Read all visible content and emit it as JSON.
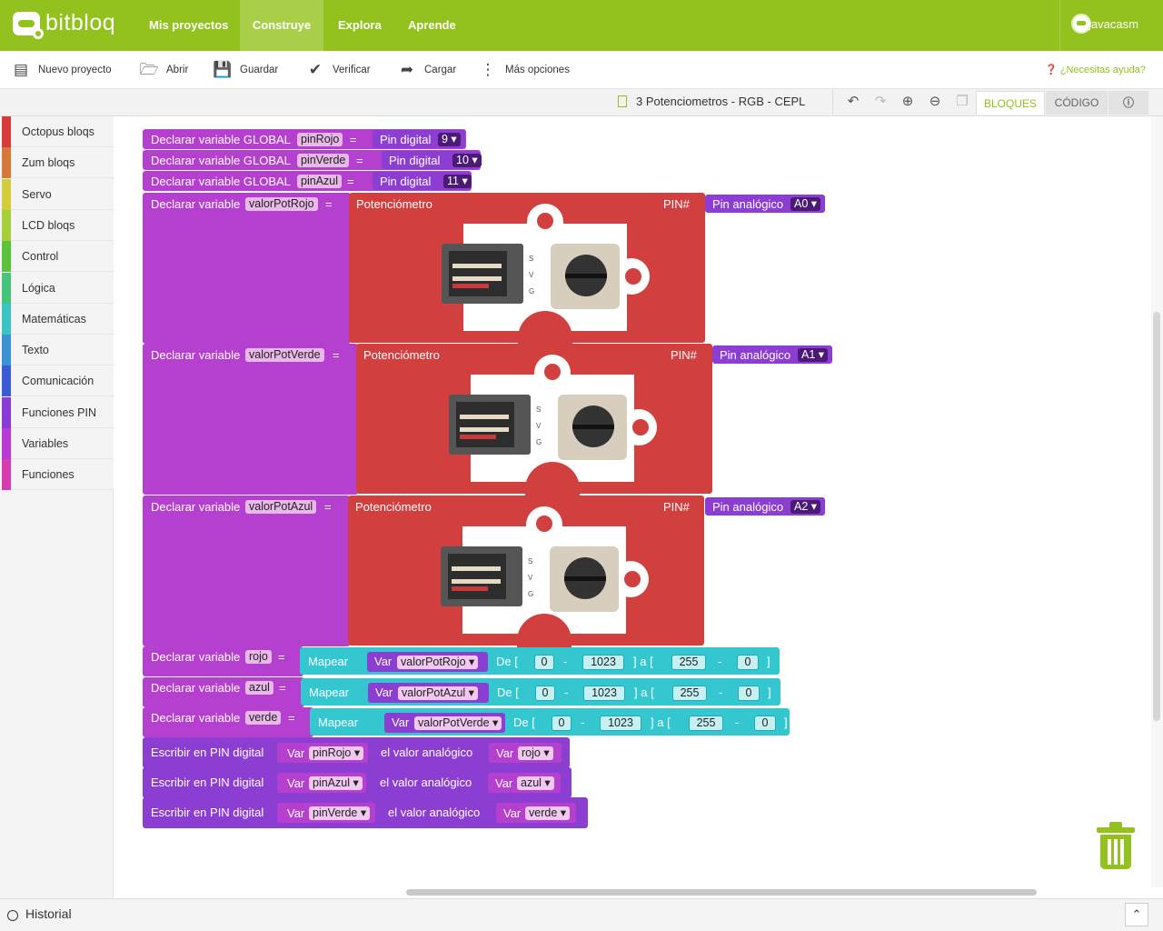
{
  "app": {
    "logo_text": "bitbloq"
  },
  "nav": {
    "items": [
      "Mis proyectos",
      "Construye",
      "Explora",
      "Aprende"
    ],
    "active": "Construye"
  },
  "user": {
    "name": "javacasm"
  },
  "toolbar": {
    "nuevo": "Nuevo proyecto",
    "abrir": "Abrir",
    "guardar": "Guardar",
    "verificar": "Verificar",
    "cargar": "Cargar",
    "mas": "Más opciones",
    "help": "¿Necesitas ayuda?"
  },
  "project": {
    "name": "3 Potenciometros - RGB - CEPL"
  },
  "view_tabs": {
    "bloques": "BLOQUES",
    "codigo": "CÓDIGO"
  },
  "sidebar": {
    "items": [
      {
        "label": "Octopus bloqs",
        "color": "#d63b3b"
      },
      {
        "label": "Zum bloqs",
        "color": "#d5793b"
      },
      {
        "label": "Servo",
        "color": "#d3cd3b"
      },
      {
        "label": "LCD bloqs",
        "color": "#a7cf3c"
      },
      {
        "label": "Control",
        "color": "#5ac23b"
      },
      {
        "label": "Lógica",
        "color": "#45c47c"
      },
      {
        "label": "Matemáticas",
        "color": "#3cc4c4"
      },
      {
        "label": "Texto",
        "color": "#3b93d6"
      },
      {
        "label": "Comunicación",
        "color": "#3b5ad6"
      },
      {
        "label": "Funciones PIN",
        "color": "#8a3bd6"
      },
      {
        "label": "Variables",
        "color": "#b83bd6"
      },
      {
        "label": "Funciones",
        "color": "#d63bb0"
      }
    ]
  },
  "blocks": {
    "globals": [
      {
        "prefix": "Declarar variable GLOBAL",
        "name": "pinRojo",
        "eq": "=",
        "pin_label": "Pin digital",
        "pin": "9 ▾"
      },
      {
        "prefix": "Declarar variable GLOBAL",
        "name": "pinVerde",
        "eq": "=",
        "pin_label": "Pin digital",
        "pin": "10 ▾"
      },
      {
        "prefix": "Declarar variable GLOBAL",
        "name": "pinAzul",
        "eq": "=",
        "pin_label": "Pin digital",
        "pin": "11 ▾"
      }
    ],
    "pots": [
      {
        "prefix": "Declarar variable",
        "name": "valorPotRojo",
        "eq": "=",
        "label": "Potenciómetro",
        "pin_hash": "PIN#",
        "pin_label": "Pin analógico",
        "pin": "A0 ▾"
      },
      {
        "prefix": "Declarar variable",
        "name": "valorPotVerde",
        "eq": "=",
        "label": "Potenciómetro",
        "pin_hash": "PIN#",
        "pin_label": "Pin analógico",
        "pin": "A1 ▾"
      },
      {
        "prefix": "Declarar variable",
        "name": "valorPotAzul",
        "eq": "=",
        "label": "Potenciómetro",
        "pin_hash": "PIN#",
        "pin_label": "Pin analógico",
        "pin": "A2 ▾"
      }
    ],
    "board_pins": [
      "S",
      "V",
      "G"
    ],
    "maps": [
      {
        "prefix": "Declarar variable",
        "name": "rojo",
        "eq": "=",
        "mapear": "Mapear",
        "var_label": "Var",
        "var": "valorPotRojo ▾",
        "de": "De [",
        "from_min": "0",
        "dash": "-",
        "from_max": "1023",
        "close_a": "]  a [",
        "to_min": "255",
        "to_max": "0",
        "close": "]"
      },
      {
        "prefix": "Declarar variable",
        "name": "azul",
        "eq": "=",
        "mapear": "Mapear",
        "var_label": "Var",
        "var": "valorPotAzul ▾",
        "de": "De [",
        "from_min": "0",
        "dash": "-",
        "from_max": "1023",
        "close_a": "]  a [",
        "to_min": "255",
        "to_max": "0",
        "close": "]"
      },
      {
        "prefix": "Declarar variable",
        "name": "verde",
        "eq": "=",
        "mapear": "Mapear",
        "var_label": "Var",
        "var": "valorPotVerde ▾",
        "de": "De [",
        "from_min": "0",
        "dash": "-",
        "from_max": "1023",
        "close_a": "]  a [",
        "to_min": "255",
        "to_max": "0",
        "close": "]"
      }
    ],
    "writes": [
      {
        "prefix": "Escribir en PIN digital",
        "var_label": "Var",
        "pin_var": "pinRojo ▾",
        "mid": "el valor analógico",
        "val_var": "rojo ▾"
      },
      {
        "prefix": "Escribir en PIN digital",
        "var_label": "Var",
        "pin_var": "pinAzul ▾",
        "mid": "el valor analógico",
        "val_var": "azul ▾"
      },
      {
        "prefix": "Escribir en PIN digital",
        "var_label": "Var",
        "pin_var": "pinVerde ▾",
        "mid": "el valor analógico",
        "val_var": "verde ▾"
      }
    ]
  },
  "footer": {
    "historial": "Historial"
  },
  "colors": {
    "brand": "#93c11d",
    "variable_block": "#b540d0",
    "octopus_block": "#d23f3f",
    "map_block": "#35c7d0",
    "pin_block": "#8b3ed1"
  }
}
